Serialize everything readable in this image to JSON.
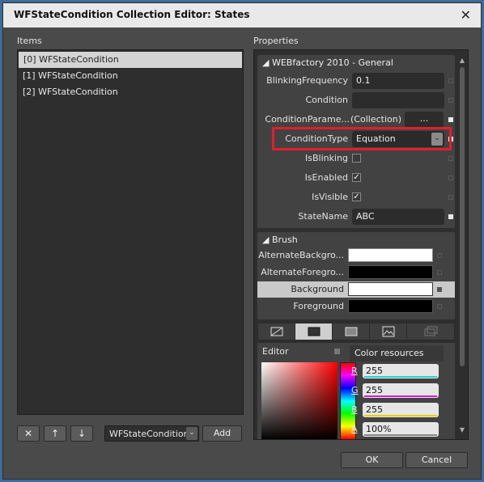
{
  "window": {
    "title": "WFStateCondition Collection Editor: States"
  },
  "items": {
    "label": "Items",
    "list": [
      "[0] WFStateCondition",
      "[1] WFStateCondition",
      "[2] WFStateCondition"
    ],
    "type_select": "WFStateCondition",
    "add_label": "Add"
  },
  "properties": {
    "label": "Properties",
    "general_group": "WEBfactory 2010 - General",
    "rows": [
      {
        "name": "BlinkingFrequency",
        "value": "0.1"
      },
      {
        "name": "Condition",
        "value": ""
      },
      {
        "name": "ConditionParame...",
        "value": "(Collection)",
        "button": "..."
      },
      {
        "name": "ConditionType",
        "value": "Equation"
      },
      {
        "name": "IsBlinking",
        "checked": false
      },
      {
        "name": "IsEnabled",
        "checked": true
      },
      {
        "name": "IsVisible",
        "checked": true
      },
      {
        "name": "StateName",
        "value": "ABC"
      }
    ],
    "brush_group": "Brush",
    "brushes": [
      {
        "name": "AlternateBackgro...",
        "color": "#ffffff"
      },
      {
        "name": "AlternateForegro...",
        "color": "#000000"
      },
      {
        "name": "Background",
        "color": "#ffffff"
      },
      {
        "name": "Foreground",
        "color": "#000000"
      }
    ],
    "editor_label": "Editor",
    "color_resources_label": "Color resources",
    "channels": [
      {
        "ch": "R",
        "value": "255",
        "bar": "#2ad0d0"
      },
      {
        "ch": "G",
        "value": "255",
        "bar": "#d020d0"
      },
      {
        "ch": "B",
        "value": "255",
        "bar": "#e0d000"
      },
      {
        "ch": "A",
        "value": "100%",
        "bar": "#888888"
      }
    ]
  },
  "footer": {
    "ok_label": "OK",
    "cancel_label": "Cancel"
  }
}
